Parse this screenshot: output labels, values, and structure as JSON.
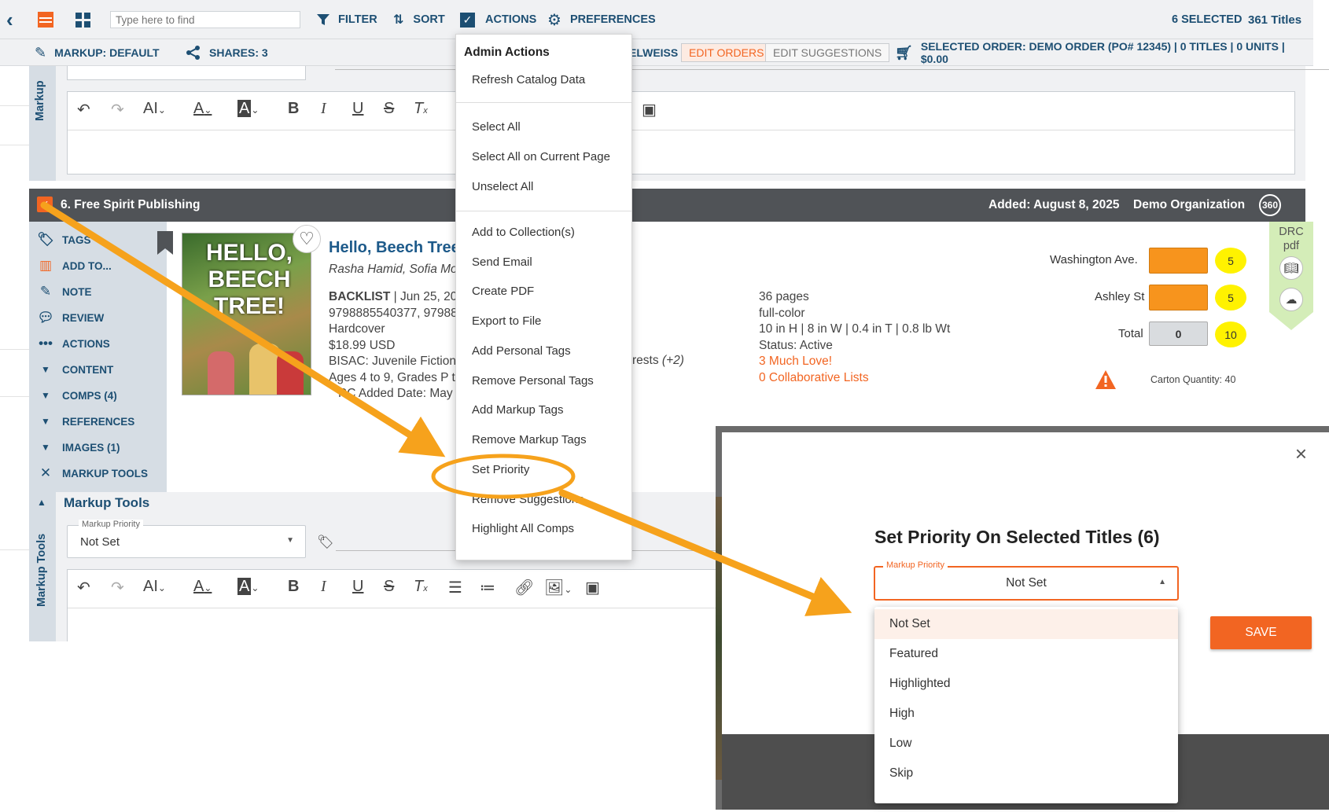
{
  "toolbar": {
    "search_placeholder": "Type here to find",
    "filter_label": "FILTER",
    "sort_label": "SORT",
    "actions_label": "ACTIONS",
    "preferences_label": "PREFERENCES",
    "selected_count": "6 SELECTED",
    "titles_count": "361 Titles"
  },
  "subbar": {
    "markup_label": "MARKUP: DEFAULT",
    "shares_label": "SHARES: 3",
    "owner_fragment": "ELWEISS",
    "edit_orders": "EDIT ORDERS",
    "edit_suggestions": "EDIT SUGGESTIONS",
    "selected_order": "SELECTED ORDER: DEMO ORDER (PO# 12345) | 0 TITLES | 0 UNITS | $0.00"
  },
  "side_labels": {
    "markup": "Markup",
    "markup_tools": "Markup Tools"
  },
  "record": {
    "header_title": "6. Free Spirit Publishing",
    "added": "Added: August 8, 2025",
    "org": "Demo Organization",
    "badge_360": "360",
    "title": "Hello, Beech Tree",
    "authors": "Rasha Hamid, Sofia Mo",
    "status_bold": "BACKLIST",
    "date_partial": "| Jun 25, 202",
    "isbns": "9798885540377, 97988",
    "format": "Hardcover",
    "price": "$18.99 USD",
    "bisac": "BISAC: Juvenile Fiction",
    "ages": "Ages 4 to 9, Grades P t",
    "drc_added": "RC Added Date: May",
    "interests": "rests",
    "interests_more": "(+2)",
    "pages": "36 pages",
    "color": "full-color",
    "dims": "10 in H | 8 in W | 0.4 in T | 0.8 lb Wt",
    "status": "Status: Active",
    "love": "3 Much Love!",
    "collab": "0 Collaborative Lists",
    "cover_text": "HELLO, BEECH TREE!"
  },
  "branches": [
    {
      "name": "Washington Ave.",
      "qty": "",
      "badge": "5"
    },
    {
      "name": "Ashley St",
      "qty": "",
      "badge": "5"
    }
  ],
  "total": {
    "label": "Total",
    "qty": "0",
    "badge": "10"
  },
  "carton": "Carton Quantity: 40",
  "drc": {
    "line1": "DRC",
    "line2": "pdf"
  },
  "side_menu": [
    {
      "label": "TAGS",
      "icon": "tag-icon"
    },
    {
      "label": "ADD TO...",
      "icon": "library-icon"
    },
    {
      "label": "NOTE",
      "icon": "pencil-icon"
    },
    {
      "label": "REVIEW",
      "icon": "speech-bubble-icon"
    },
    {
      "label": "ACTIONS",
      "icon": "dots-icon"
    },
    {
      "label": "CONTENT",
      "icon": "caret-down-icon"
    },
    {
      "label": "COMPS (4)",
      "icon": "caret-down-icon"
    },
    {
      "label": "REFERENCES",
      "icon": "caret-down-icon"
    },
    {
      "label": "IMAGES (1)",
      "icon": "caret-down-icon"
    },
    {
      "label": "MARKUP TOOLS",
      "icon": "tools-icon"
    }
  ],
  "markup_tools": {
    "heading": "Markup Tools",
    "priority_label": "Markup Priority",
    "priority_value": "Not Set"
  },
  "actions_menu": {
    "heading": "Admin Actions",
    "items": [
      "Refresh Catalog Data",
      "Select All",
      "Select All on Current Page",
      "Unselect All",
      "Add to Collection(s)",
      "Send Email",
      "Create PDF",
      "Export to File",
      "Add Personal Tags",
      "Remove Personal Tags",
      "Add Markup Tags",
      "Remove Markup Tags",
      "Set Priority",
      "Remove Suggestions",
      "Highlight All Comps"
    ]
  },
  "modal": {
    "title": "Set Priority On Selected Titles (6)",
    "field_label": "Markup Priority",
    "field_value": "Not Set",
    "save_label": "SAVE",
    "options": [
      "Not Set",
      "Featured",
      "Highlighted",
      "High",
      "Low",
      "Skip"
    ]
  },
  "colors": {
    "accent_orange": "#f26522",
    "brand_blue": "#1d4f73",
    "annotation_orange": "#f6a21c",
    "badge_yellow": "#fff200"
  }
}
